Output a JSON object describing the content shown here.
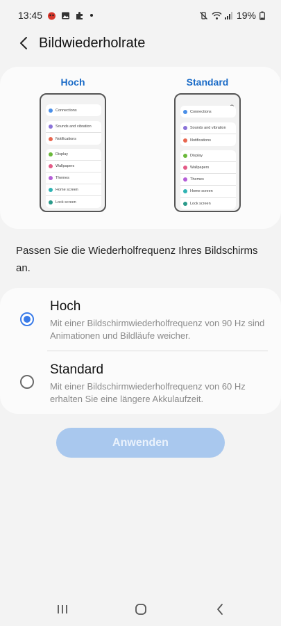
{
  "status_bar": {
    "time": "13:45",
    "battery": "19%",
    "notification_icons": [
      "app-red-icon",
      "gallery-icon",
      "puzzle-icon"
    ],
    "system_icons": [
      "mute-vibrate-icon",
      "wifi-icon",
      "signal-icon",
      "battery-icon"
    ]
  },
  "header": {
    "title": "Bildwiederholrate"
  },
  "preview": {
    "left_label": "Hoch",
    "right_label": "Standard",
    "left_phone": {
      "group1": [
        {
          "label": "Connections",
          "color": "#4a8fe8"
        }
      ],
      "group2": [
        {
          "label": "Sounds and vibration",
          "color": "#8a72d8"
        },
        {
          "label": "Notifications",
          "color": "#e8664f"
        }
      ],
      "group3": [
        {
          "label": "Display",
          "color": "#6ab83a"
        },
        {
          "label": "Wallpapers",
          "color": "#e35a86"
        },
        {
          "label": "Themes",
          "color": "#b55fd8"
        },
        {
          "label": "Home screen",
          "color": "#2fb3b3"
        },
        {
          "label": "Lock screen",
          "color": "#2a9a8a"
        }
      ]
    },
    "right_phone": {
      "group1": [
        {
          "label": "Connections",
          "color": "#4a8fe8"
        }
      ],
      "group2": [
        {
          "label": "Sounds and vibration",
          "color": "#8a72d8"
        },
        {
          "label": "Notifications",
          "color": "#e8664f"
        }
      ],
      "group3": [
        {
          "label": "Display",
          "color": "#6ab83a"
        },
        {
          "label": "Wallpapers",
          "color": "#e35a86"
        },
        {
          "label": "Themes",
          "color": "#b55fd8"
        },
        {
          "label": "Home screen",
          "color": "#2fb3b3"
        },
        {
          "label": "Lock screen",
          "color": "#2a9a8a"
        }
      ]
    }
  },
  "description": "Passen Sie die Wiederholfrequenz Ihres Bildschirms an.",
  "options": [
    {
      "title": "Hoch",
      "description": "Mit einer Bildschirmwiederholfrequenz von 90 Hz sind Animationen und Bildläufe weicher.",
      "selected": true
    },
    {
      "title": "Standard",
      "description": "Mit einer Bildschirmwiederholfrequenz von 60 Hz erhalten Sie eine längere Akkulaufzeit.",
      "selected": false
    }
  ],
  "apply_button": {
    "label": "Anwenden",
    "enabled": false
  },
  "colors": {
    "accent": "#3a7be8",
    "label_blue": "#1a6bc7",
    "button_disabled": "#a9c8ee"
  }
}
